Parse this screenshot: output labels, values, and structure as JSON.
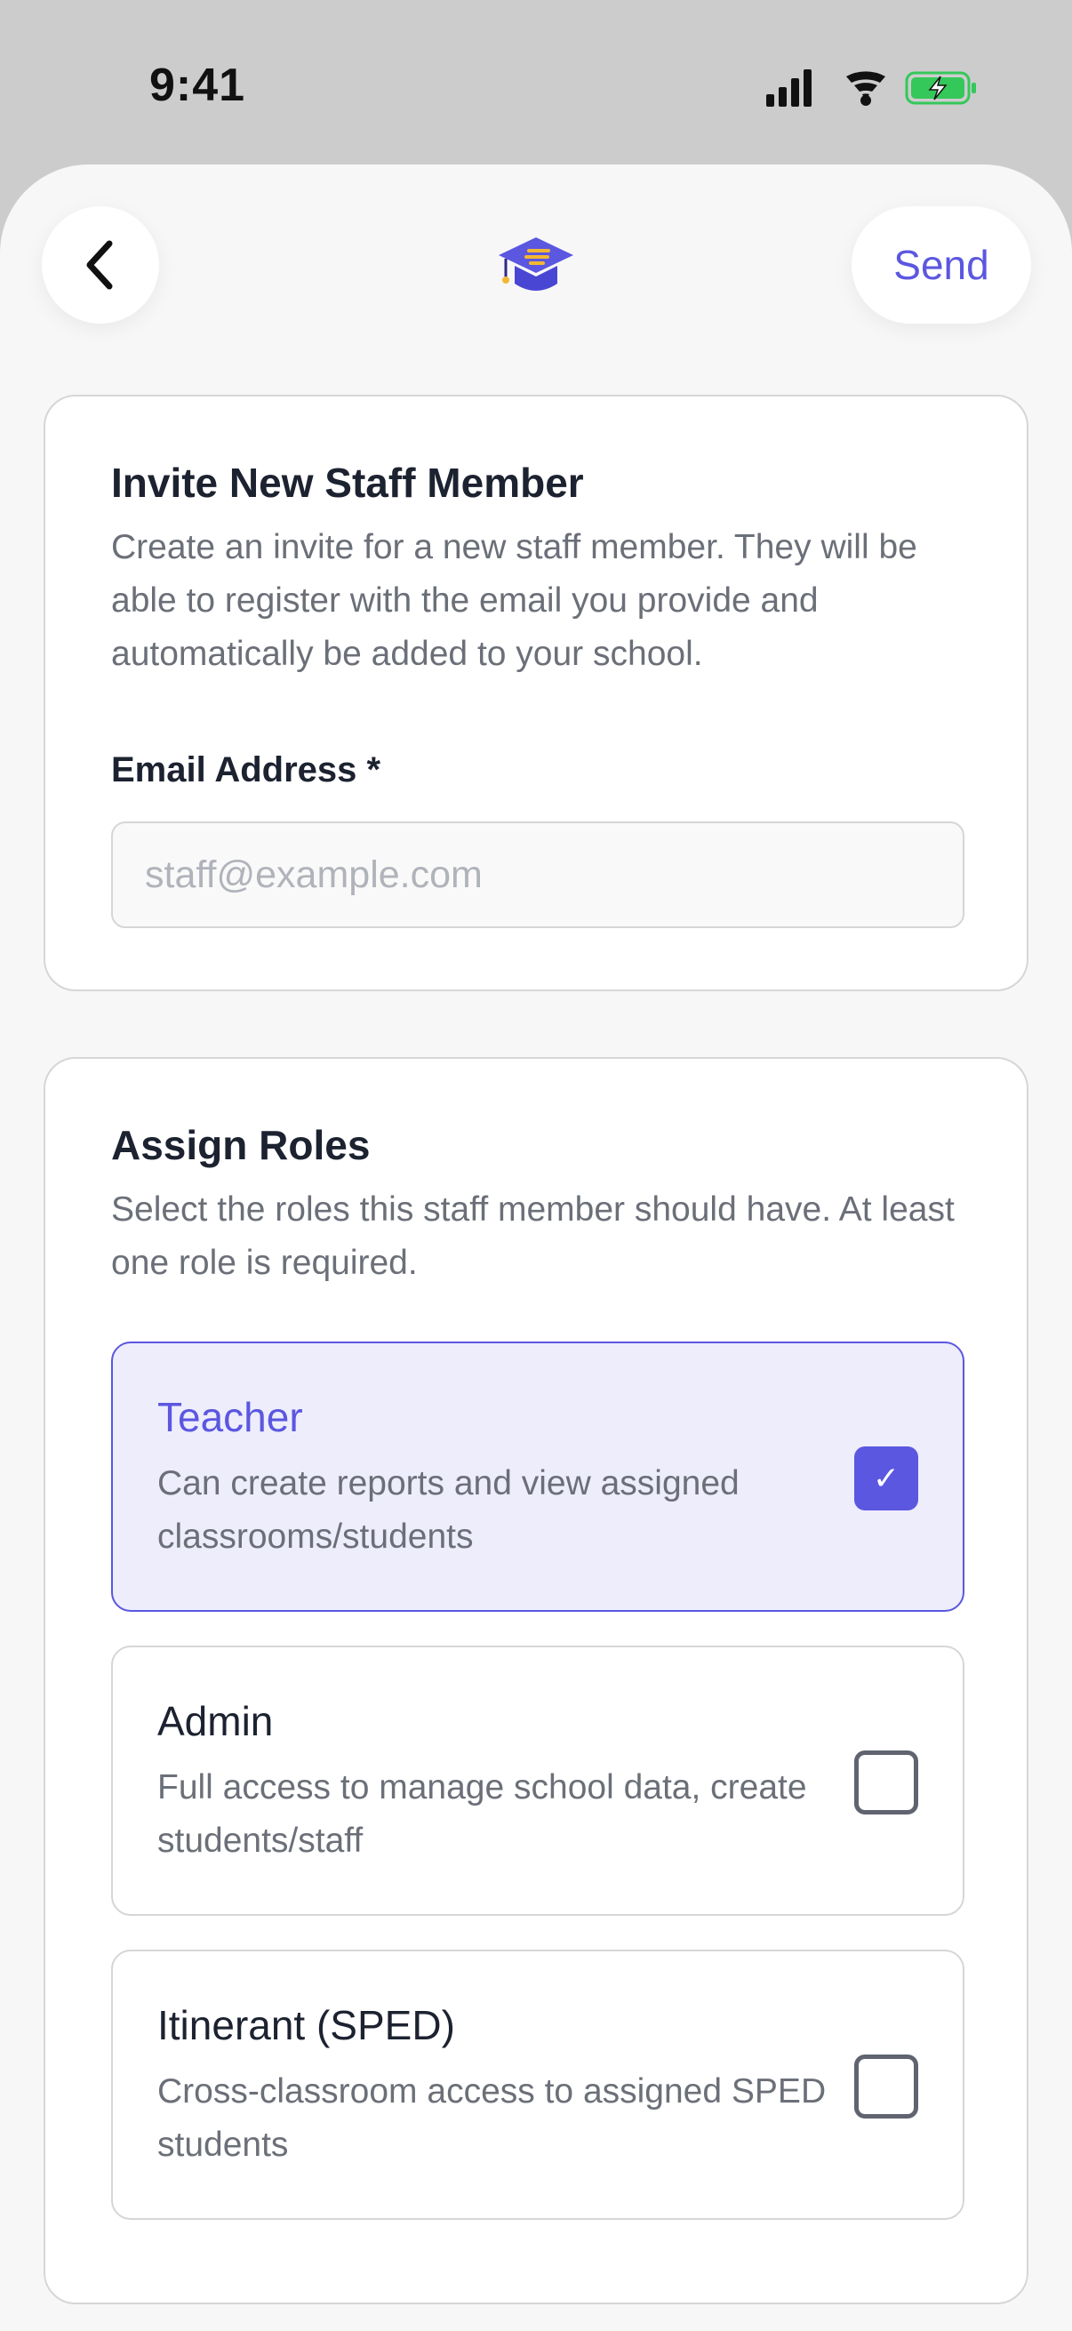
{
  "status_bar": {
    "time": "9:41",
    "icons": [
      "signal-icon",
      "wifi-icon",
      "battery-charging-icon"
    ]
  },
  "nav": {
    "back_icon": "chevron-left-icon",
    "logo_icon": "graduation-cap-icon",
    "send_label": "Send"
  },
  "invite_card": {
    "title": "Invite New Staff Member",
    "description": "Create an invite for a new staff member. They will be able to register with the email you provide and automatically be added to your school.",
    "email_label": "Email Address *",
    "email_placeholder": "staff@example.com",
    "email_value": ""
  },
  "roles_card": {
    "title": "Assign Roles",
    "description": "Select the roles this staff member should have. At least one role is required.",
    "roles": [
      {
        "title": "Teacher",
        "description": "Can create reports and view assigned classrooms/students",
        "checked": true
      },
      {
        "title": "Admin",
        "description": "Full access to manage school data, create students/staff",
        "checked": false
      },
      {
        "title": "Itinerant (SPED)",
        "description": "Cross-classroom access to assigned SPED students",
        "checked": false
      }
    ]
  },
  "colors": {
    "accent": "#5b57e0",
    "selected_bg": "#eeedfc",
    "battery": "#34c759",
    "logo_gold": "#f4b731"
  },
  "check_glyph": "✓"
}
